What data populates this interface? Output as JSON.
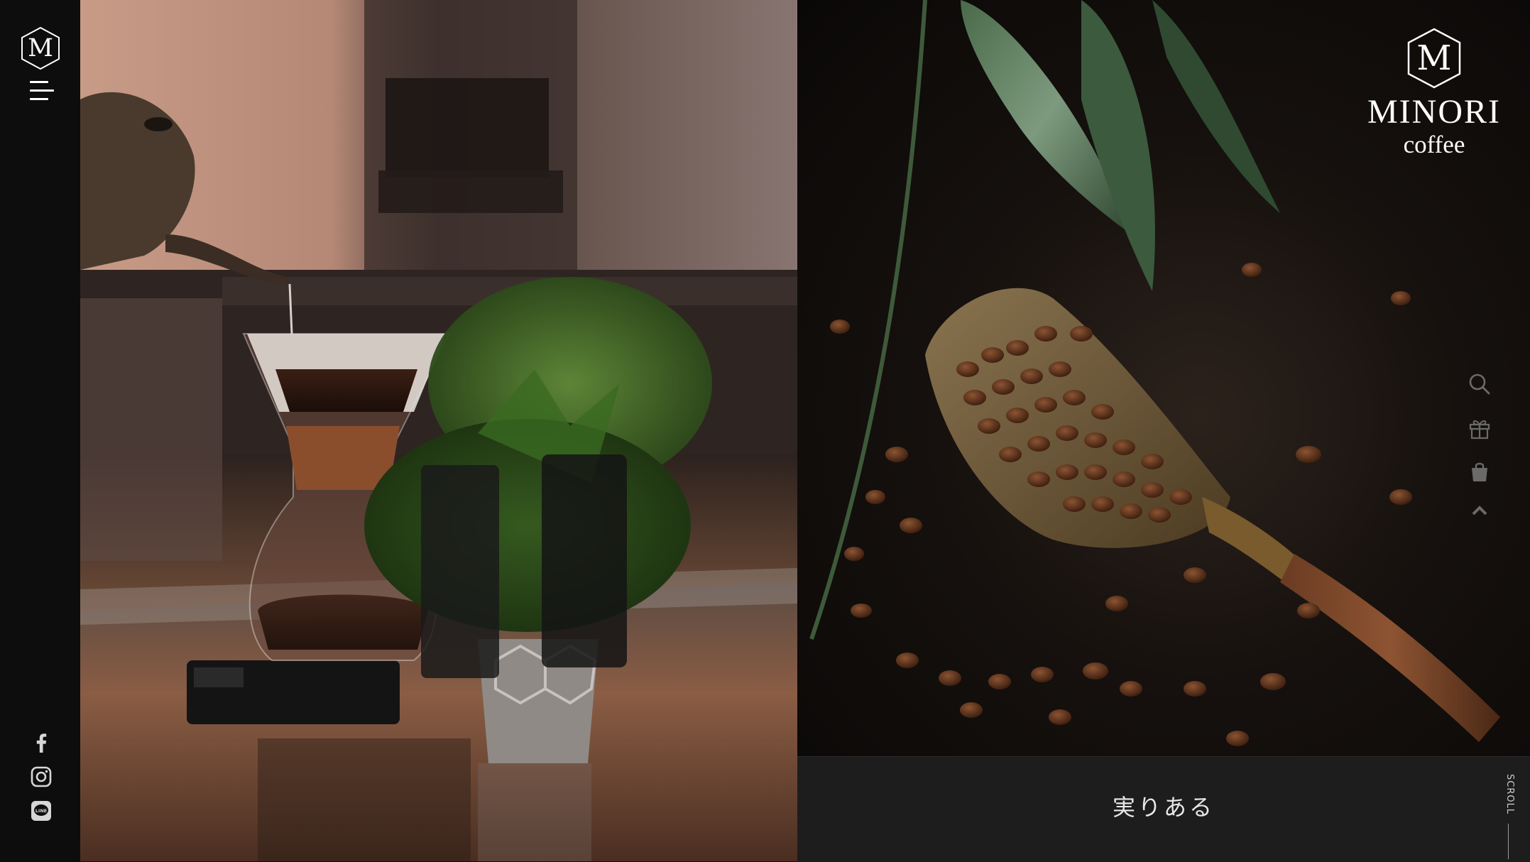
{
  "sidebar": {
    "logo_letter": "M",
    "menu_icon": "hamburger-menu-icon",
    "social": [
      {
        "name": "facebook",
        "icon": "facebook-icon"
      },
      {
        "name": "instagram",
        "icon": "instagram-icon"
      },
      {
        "name": "line",
        "icon": "line-icon",
        "label": "LINE"
      }
    ]
  },
  "brand": {
    "mark_letter": "M",
    "name": "MINORI",
    "sub": "coffee"
  },
  "tools": [
    {
      "name": "search",
      "icon": "search-icon"
    },
    {
      "name": "gift",
      "icon": "gift-icon"
    },
    {
      "name": "shopping-bag",
      "icon": "shopping-bag-icon"
    },
    {
      "name": "scroll-top",
      "icon": "chevron-up-icon"
    }
  ],
  "hero": {
    "left_image": "coffee-pour-over-photo",
    "right_image": "coffee-beans-scoop-photo",
    "tagline": "実りある"
  },
  "scroll": {
    "label": "SCROLL"
  },
  "colors": {
    "sidebar_bg": "#0d0d0d",
    "band_bg": "#1d1d1d",
    "text": "#ffffff",
    "tool_icon": "#6a6a6a"
  }
}
